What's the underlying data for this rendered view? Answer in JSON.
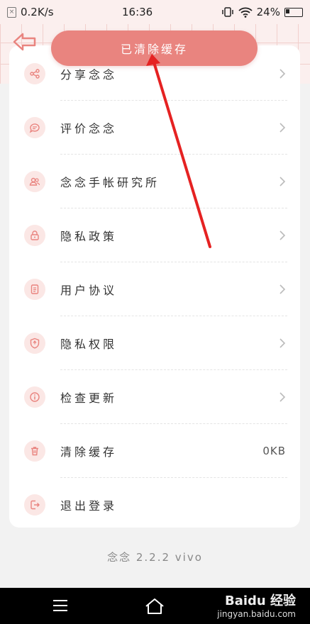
{
  "status_bar": {
    "speed": "0.2K/s",
    "time": "16:36",
    "battery": "24%"
  },
  "toast": {
    "text": "已清除缓存"
  },
  "menu": [
    {
      "label": "分享念念",
      "icon": "share-icon",
      "chevron": true
    },
    {
      "label": "评价念念",
      "icon": "chat-icon",
      "chevron": true
    },
    {
      "label": "念念手帐研究所",
      "icon": "users-icon",
      "chevron": true
    },
    {
      "label": "隐私政策",
      "icon": "lock-icon",
      "chevron": true
    },
    {
      "label": "用户协议",
      "icon": "document-icon",
      "chevron": true
    },
    {
      "label": "隐私权限",
      "icon": "shield-icon",
      "chevron": true
    },
    {
      "label": "检查更新",
      "icon": "info-icon",
      "chevron": true
    },
    {
      "label": "清除缓存",
      "icon": "trash-icon",
      "value": "0KB"
    },
    {
      "label": "退出登录",
      "icon": "logout-icon"
    }
  ],
  "version": "念念 2.2.2 vivo",
  "watermark": {
    "brand": "Baidu 经验",
    "url": "jingyan.baidu.com"
  },
  "colors": {
    "accent": "#e9847f",
    "header_bg": "#fbefee",
    "arrow": "#e52222"
  }
}
